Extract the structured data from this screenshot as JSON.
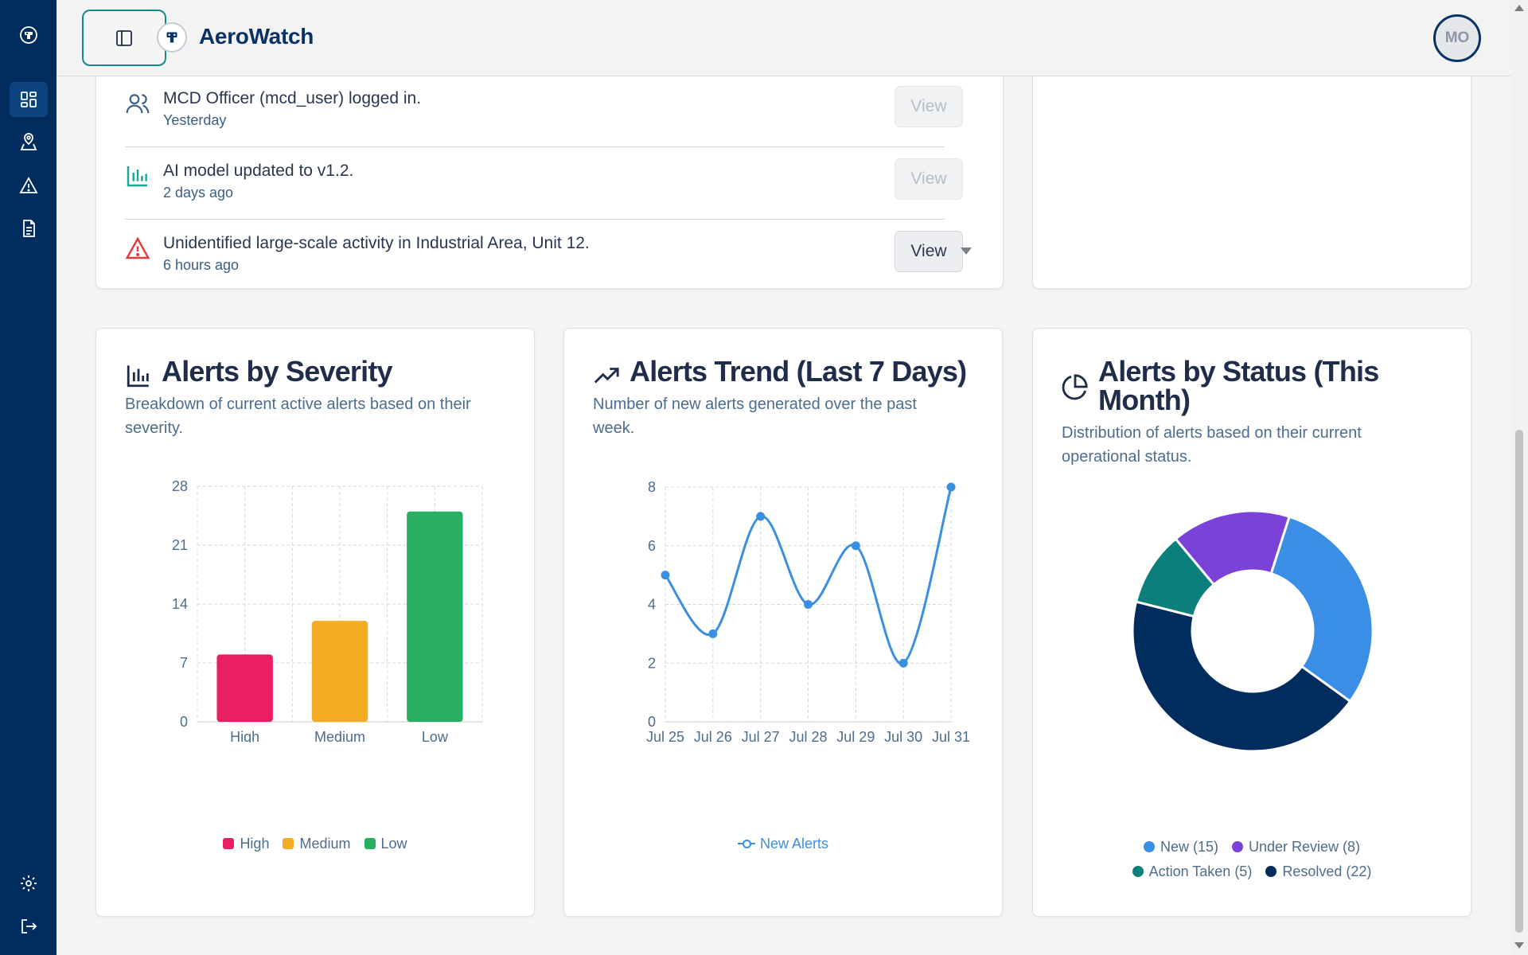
{
  "app": {
    "brand_name": "AeroWatch",
    "user_initials": "MO"
  },
  "sidebar": {
    "items": [
      {
        "name": "logo",
        "icon": "drone-logo-icon"
      },
      {
        "name": "dashboard",
        "icon": "dashboard-grid-icon",
        "active": true
      },
      {
        "name": "map",
        "icon": "map-pin-icon"
      },
      {
        "name": "alerts",
        "icon": "warning-triangle-icon"
      },
      {
        "name": "reports",
        "icon": "document-icon"
      },
      {
        "name": "settings",
        "icon": "gear-icon"
      },
      {
        "name": "logout",
        "icon": "logout-icon"
      }
    ]
  },
  "activity": {
    "items": [
      {
        "icon": "users-icon",
        "title": "MCD Officer (mcd_user) logged in.",
        "time": "Yesterday",
        "action": "View",
        "enabled": false
      },
      {
        "icon": "bar-chart-icon",
        "title": "AI model updated to v1.2.",
        "time": "2 days ago",
        "action": "View",
        "enabled": false
      },
      {
        "icon": "warning-icon",
        "title": "Unidentified large-scale activity in Industrial Area, Unit 12.",
        "time": "6 hours ago",
        "action": "View",
        "enabled": true
      }
    ]
  },
  "severity": {
    "title": "Alerts by Severity",
    "subtitle_1": "Breakdown of current active alerts based on their",
    "subtitle_2": "severity."
  },
  "trend": {
    "title": "Alerts Trend (Last 7 Days)",
    "subtitle_1": "Number of new alerts generated over the past",
    "subtitle_2": "week."
  },
  "status": {
    "title_1": "Alerts by Status (This",
    "title_2": "Month)",
    "subtitle_1": "Distribution of alerts based on their current",
    "subtitle_2": "operational status."
  },
  "chart_data": [
    {
      "type": "bar",
      "categories": [
        "High",
        "Medium",
        "Low"
      ],
      "values": [
        8,
        12,
        25
      ],
      "colors": [
        "#e91e63",
        "#f4ac23",
        "#27ae60"
      ],
      "legend": [
        "High",
        "Medium",
        "Low"
      ],
      "yticks": [
        "0",
        "7",
        "14",
        "21",
        "28"
      ],
      "ylim": [
        0,
        28
      ],
      "grid": true,
      "legend_position": "bottom"
    },
    {
      "type": "line",
      "x": [
        "Jul 25",
        "Jul 26",
        "Jul 27",
        "Jul 28",
        "Jul 29",
        "Jul 30",
        "Jul 31"
      ],
      "series": [
        {
          "name": "New Alerts",
          "values": [
            5,
            3,
            7,
            4,
            6,
            2,
            8
          ],
          "color": "#3b8fe0"
        }
      ],
      "yticks": [
        "0",
        "2",
        "4",
        "6",
        "8"
      ],
      "ylim": [
        0,
        8
      ],
      "grid": true,
      "legend_position": "bottom"
    },
    {
      "type": "pie",
      "donut": true,
      "labels": [
        "New",
        "Resolved",
        "Action Taken",
        "Under Review"
      ],
      "values": [
        15,
        22,
        5,
        8
      ],
      "colors": [
        "#3a8ee6",
        "#002d5e",
        "#0b7f7b",
        "#7a42d6"
      ],
      "legend": [
        {
          "label": "New (15)",
          "color": "#3a8ee6"
        },
        {
          "label": "Under Review (8)",
          "color": "#7a42d6"
        },
        {
          "label": "Action Taken (5)",
          "color": "#0b7f7b"
        },
        {
          "label": "Resolved (22)",
          "color": "#002d5e"
        }
      ],
      "legend_position": "bottom"
    }
  ]
}
